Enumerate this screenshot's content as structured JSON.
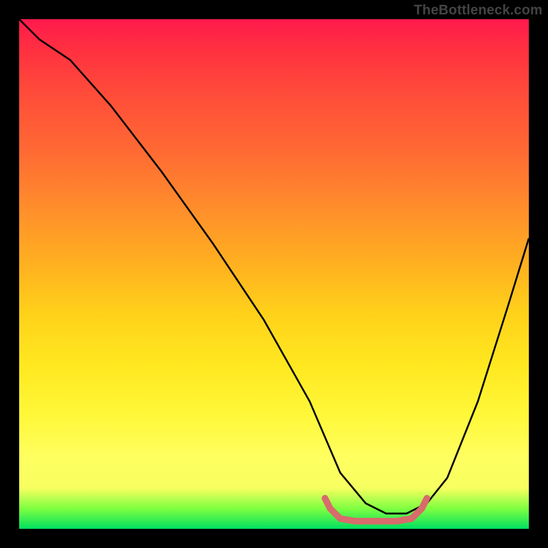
{
  "watermark": "TheBottleneck.com",
  "gradient": {
    "stops": [
      {
        "pct": 0,
        "color": "#ff1a4d"
      },
      {
        "pct": 6,
        "color": "#ff3040"
      },
      {
        "pct": 14,
        "color": "#ff4a3a"
      },
      {
        "pct": 26,
        "color": "#ff6a33"
      },
      {
        "pct": 36,
        "color": "#ff8a2c"
      },
      {
        "pct": 48,
        "color": "#ffb020"
      },
      {
        "pct": 58,
        "color": "#ffd21a"
      },
      {
        "pct": 68,
        "color": "#ffe820"
      },
      {
        "pct": 78,
        "color": "#fff83a"
      },
      {
        "pct": 86,
        "color": "#ffff60"
      },
      {
        "pct": 92,
        "color": "#f7ff60"
      },
      {
        "pct": 96,
        "color": "#7fff40"
      },
      {
        "pct": 100,
        "color": "#00e060"
      }
    ]
  },
  "chart_data": {
    "type": "line",
    "title": "",
    "xlabel": "",
    "ylabel": "",
    "xlim": [
      0,
      100
    ],
    "ylim": [
      0,
      100
    ],
    "series": [
      {
        "name": "bottleneck-curve",
        "color": "#000000",
        "x": [
          0,
          4,
          10,
          18,
          28,
          38,
          48,
          57,
          60,
          63,
          68,
          72,
          76,
          80,
          84,
          90,
          96,
          100
        ],
        "y": [
          100,
          96,
          92,
          83,
          70,
          56,
          41,
          25,
          18,
          11,
          5,
          3,
          3,
          5,
          10,
          25,
          44,
          57
        ]
      },
      {
        "name": "optimum-marker",
        "color": "#d86b6b",
        "x": [
          60,
          61,
          63,
          66,
          70,
          74,
          77,
          79,
          80
        ],
        "y": [
          6,
          4,
          2,
          1.5,
          1.5,
          1.5,
          2,
          4,
          6
        ]
      }
    ]
  }
}
